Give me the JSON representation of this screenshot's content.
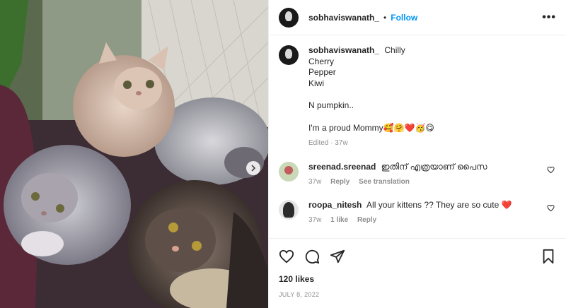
{
  "header": {
    "username": "sobhaviswanath_",
    "separator": "•",
    "follow_label": "Follow",
    "more_label": "•••"
  },
  "caption": {
    "username": "sobhaviswanath_",
    "lines": [
      "Chilly",
      "Cherry",
      "Pepper",
      "Kiwi"
    ],
    "line2": "N pumpkin..",
    "line3": "I'm a proud Mommy🥰🤗❤️🥳😋",
    "edited": "Edited · 37w"
  },
  "comments": [
    {
      "username": "sreenad.sreenad",
      "text": "ഇതിന് എത്രയാണ് പൈസ",
      "time": "37w",
      "reply_label": "Reply",
      "translate_label": "See translation"
    },
    {
      "username": "roopa_nitesh",
      "text": "All your kittens ?? They are so cute ❤️",
      "time": "37w",
      "likes_label": "1 like",
      "reply_label": "Reply"
    }
  ],
  "icons": {
    "like": "heart-icon",
    "comment": "comment-icon",
    "share": "share-icon",
    "save": "bookmark-icon",
    "next": "chevron-right-icon",
    "comment_like": "heart-icon"
  },
  "likes": "120 likes",
  "date": "JULY 8, 2022",
  "colors": {
    "accent": "#0095f6",
    "muted": "#8e8e8e",
    "text": "#262626"
  }
}
